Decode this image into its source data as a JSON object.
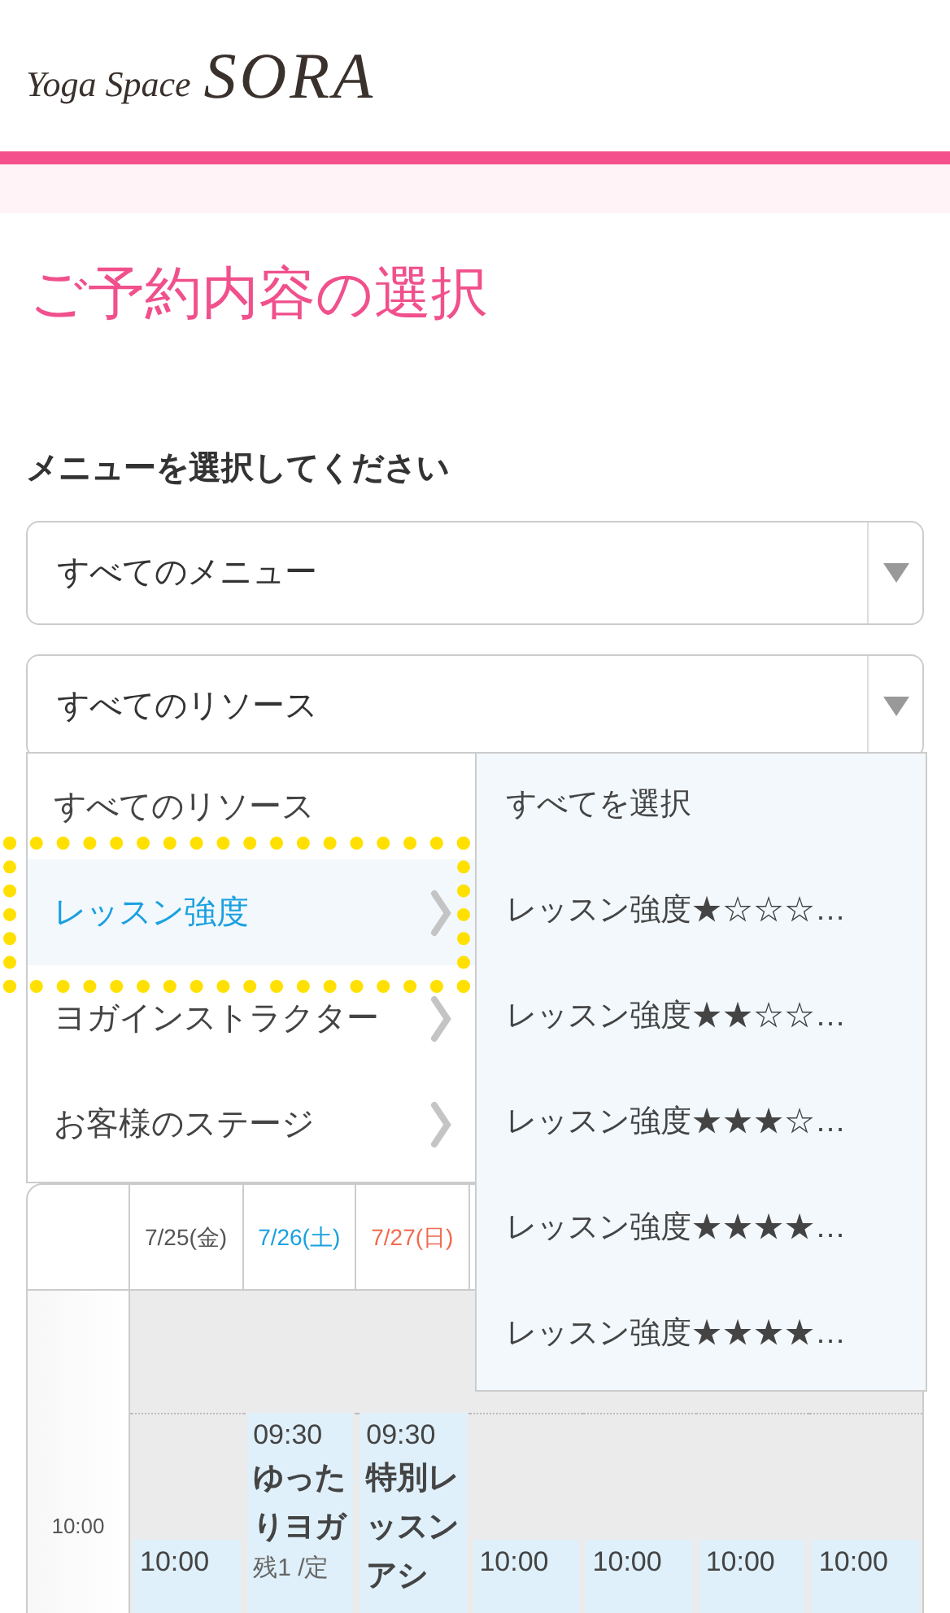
{
  "logo": {
    "small": "Yoga Space",
    "large": "SORA"
  },
  "title": "ご予約内容の選択",
  "menu_label": "メニューを選択してください",
  "selects": [
    {
      "value": "すべてのメニュー"
    },
    {
      "value": "すべてのリソース"
    }
  ],
  "resource_menu": {
    "items": [
      {
        "label": "すべてのリソース",
        "selected": false,
        "has_submenu": false
      },
      {
        "label": "レッスン強度",
        "selected": true,
        "has_submenu": true
      },
      {
        "label": "ヨガインストラクター",
        "selected": false,
        "has_submenu": true
      },
      {
        "label": "お客様のステージ",
        "selected": false,
        "has_submenu": true
      }
    ],
    "submenu": [
      "すべてを選択",
      "レッスン強度★☆☆☆…",
      "レッスン強度★★☆☆…",
      "レッスン強度★★★☆…",
      "レッスン強度★★★★…",
      "レッスン強度★★★★…"
    ]
  },
  "calendar": {
    "time_labels": [
      "10:00"
    ],
    "columns": [
      {
        "day": {
          "label": "7/25(金)",
          "kind": "weekday"
        },
        "late_event": {
          "time": "10:00"
        }
      },
      {
        "day": {
          "label": "7/26(土)",
          "kind": "saturday"
        },
        "early_event": {
          "time": "09:30",
          "title": "ゆったりヨガ",
          "note": "残1 /定"
        }
      },
      {
        "day": {
          "label": "7/27(日)",
          "kind": "sunday"
        },
        "early_event": {
          "time": "09:30",
          "title": "特別レッスンアシ"
        }
      },
      {
        "late_event": {
          "time": "10:00"
        }
      },
      {
        "late_event": {
          "time": "10:00"
        }
      },
      {
        "late_event": {
          "time": "10:00"
        }
      },
      {
        "late_event": {
          "time": "10:00"
        }
      }
    ]
  }
}
